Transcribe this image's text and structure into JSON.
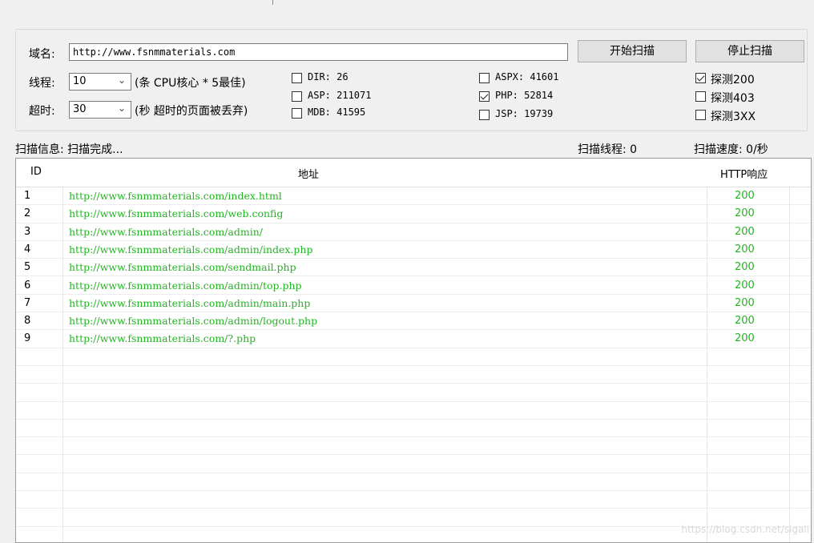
{
  "form": {
    "domain_label": "域名:",
    "domain_value": "http://www.fsnmmaterials.com",
    "start_button": "开始扫描",
    "stop_button": "停止扫描",
    "threads_label": "线程:",
    "threads_value": "10",
    "threads_hint": "(条 CPU核心 * 5最佳)",
    "timeout_label": "超时:",
    "timeout_value": "30",
    "timeout_hint": "(秒 超时的页面被丢弃)"
  },
  "dicts": [
    {
      "label": "DIR: 26",
      "checked": false
    },
    {
      "label": "ASP: 211071",
      "checked": false
    },
    {
      "label": "MDB: 41595",
      "checked": false
    },
    {
      "label": "ASPX: 41601",
      "checked": false
    },
    {
      "label": "PHP: 52814",
      "checked": true
    },
    {
      "label": "JSP: 19739",
      "checked": false
    }
  ],
  "probes": [
    {
      "label": "探测200",
      "checked": true
    },
    {
      "label": "探测403",
      "checked": false
    },
    {
      "label": "探测3XX",
      "checked": false
    }
  ],
  "status": {
    "info": "扫描信息: 扫描完成...",
    "threads": "扫描线程: 0",
    "speed": "扫描速度: 0/秒"
  },
  "table": {
    "headers": {
      "id": "ID",
      "url": "地址",
      "code": "HTTP响应"
    },
    "rows": [
      {
        "id": "1",
        "url": "http://www.fsnmmaterials.com/index.html",
        "code": "200"
      },
      {
        "id": "2",
        "url": "http://www.fsnmmaterials.com/web.config",
        "code": "200"
      },
      {
        "id": "3",
        "url": "http://www.fsnmmaterials.com/admin/",
        "code": "200"
      },
      {
        "id": "4",
        "url": "http://www.fsnmmaterials.com/admin/index.php",
        "code": "200"
      },
      {
        "id": "5",
        "url": "http://www.fsnmmaterials.com/sendmail.php",
        "code": "200"
      },
      {
        "id": "6",
        "url": "http://www.fsnmmaterials.com/admin/top.php",
        "code": "200"
      },
      {
        "id": "7",
        "url": "http://www.fsnmmaterials.com/admin/main.php",
        "code": "200"
      },
      {
        "id": "8",
        "url": "http://www.fsnmmaterials.com/admin/logout.php",
        "code": "200"
      },
      {
        "id": "9",
        "url": "http://www.fsnmmaterials.com/?.php",
        "code": "200"
      }
    ]
  },
  "watermark": "https://blog.csdn.net/sigali",
  "colors": {
    "ok": "#22b422"
  }
}
